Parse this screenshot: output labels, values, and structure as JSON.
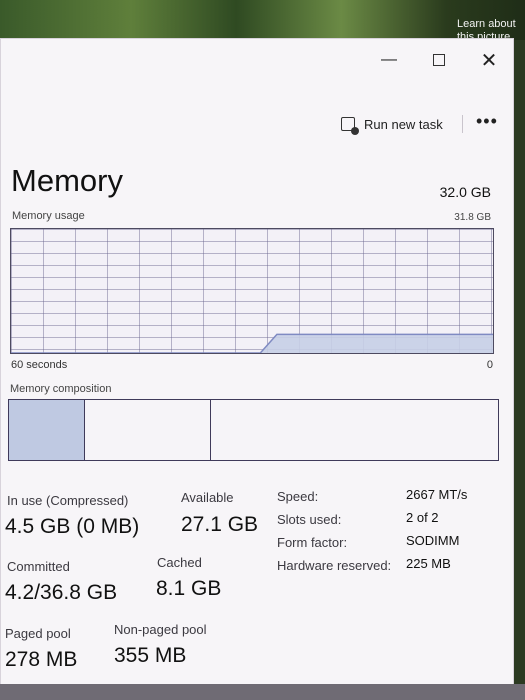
{
  "wallpaper": {
    "caption": "Learn about this picture"
  },
  "window": {
    "minimize_glyph": "—",
    "close_glyph": "✕"
  },
  "toolbar": {
    "run_new_task_label": "Run new task",
    "more_glyph": "•••"
  },
  "memory": {
    "title": "Memory",
    "total": "32.0 GB",
    "usage_label": "Memory usage",
    "usage_max": "31.8 GB",
    "time_left": "60 seconds",
    "time_right": "0",
    "composition_label": "Memory composition",
    "usage_history_fraction": [
      0,
      0,
      0,
      0,
      0,
      0,
      0,
      0,
      0,
      0,
      0,
      0,
      0,
      0,
      0,
      0,
      0.15,
      0.15,
      0.15,
      0.15,
      0.15,
      0.15,
      0.15,
      0.15,
      0.15,
      0.15,
      0.15,
      0.15,
      0.15,
      0.15
    ],
    "chart_colors": {
      "fill": "#c7cfe6",
      "line": "#7f8ac2"
    },
    "stats": {
      "in_use_label": "In use (Compressed)",
      "in_use_value": "4.5 GB (0 MB)",
      "available_label": "Available",
      "available_value": "27.1 GB",
      "committed_label": "Committed",
      "committed_value": "4.2/36.8 GB",
      "cached_label": "Cached",
      "cached_value": "8.1 GB",
      "paged_pool_label": "Paged pool",
      "paged_pool_value": "278 MB",
      "non_paged_pool_label": "Non-paged pool",
      "non_paged_pool_value": "355 MB"
    },
    "specs": {
      "speed_label": "Speed:",
      "speed_value": "2667 MT/s",
      "slots_label": "Slots used:",
      "slots_value": "2 of 2",
      "form_factor_label": "Form factor:",
      "form_factor_value": "SODIMM",
      "hw_reserved_label": "Hardware reserved:",
      "hw_reserved_value": "225 MB"
    }
  }
}
